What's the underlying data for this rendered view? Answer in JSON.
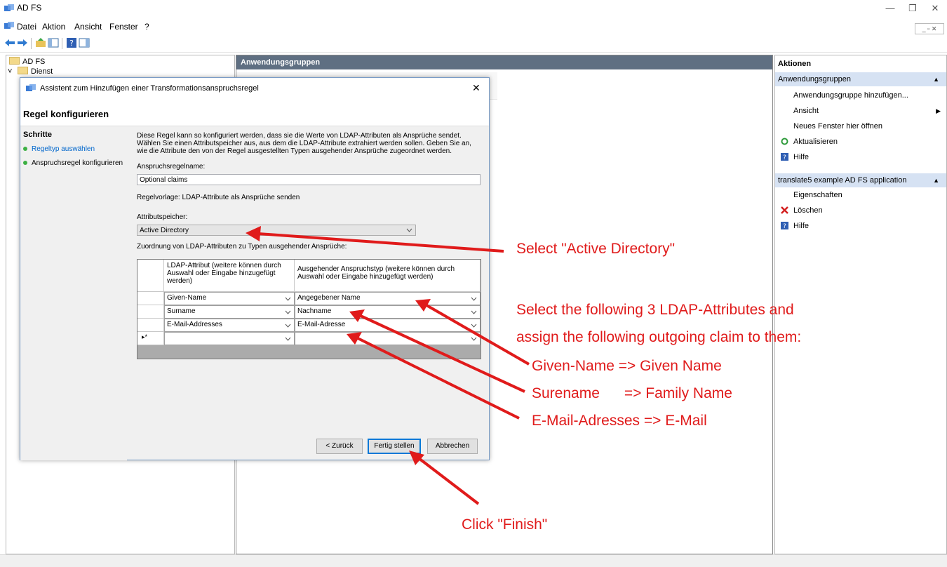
{
  "window": {
    "title": "AD FS",
    "minimize": "—",
    "restore": "❐",
    "close": "✕"
  },
  "menu": [
    "Datei",
    "Aktion",
    "Ansicht",
    "Fenster",
    "?"
  ],
  "mdi_buttons": "_ ▫ ✕",
  "tree": {
    "root": "AD FS",
    "child": "Dienst",
    "expander": "˅"
  },
  "center": {
    "header": "Anwendungsgruppen"
  },
  "actions": {
    "header": "Aktionen",
    "section1": "Anwendungsgruppen",
    "items1": [
      "Anwendungsgruppe hinzufügen...",
      "Ansicht",
      "Neues Fenster hier öffnen",
      "Aktualisieren",
      "Hilfe"
    ],
    "section2": "translate5 example AD FS application",
    "items2": [
      "Eigenschaften",
      "Löschen",
      "Hilfe"
    ],
    "collapse_glyph": "▲",
    "submenu_glyph": "▶"
  },
  "dialog": {
    "title": "Assistent zum Hinzufügen einer Transformationsanspruchsregel",
    "close": "✕",
    "heading": "Regel konfigurieren",
    "steps_title": "Schritte",
    "steps": [
      "Regeltyp auswählen",
      "Anspruchsregel konfigurieren"
    ],
    "description": "Diese Regel kann so konfiguriert werden, dass sie die Werte von LDAP-Attributen als Ansprüche sendet. Wählen Sie einen Attributspeicher aus, aus dem die LDAP-Attribute extrahiert werden sollen. Geben Sie an, wie die Attribute den von der Regel ausgestellten Typen ausgehender Ansprüche zugeordnet werden.",
    "rule_name_label": "Anspruchsregelname:",
    "rule_name_value": "Optional claims",
    "template_text": "Regelvorlage: LDAP-Attribute als Ansprüche senden",
    "store_label": "Attributspeicher:",
    "store_value": "Active Directory",
    "mapping_label": "Zuordnung von LDAP-Attributen zu Typen ausgehender Ansprüche:",
    "grid": {
      "col1": "LDAP-Attribut (weitere können durch Auswahl oder Eingabe hinzugefügt werden)",
      "col2": "Ausgehender Anspruchstyp (weitere können durch Auswahl oder Eingabe hinzugefügt werden)",
      "rows": [
        {
          "ldap": "Given-Name",
          "claim": "Angegebener Name"
        },
        {
          "ldap": "Surname",
          "claim": "Nachname"
        },
        {
          "ldap": "E-Mail-Addresses",
          "claim": "E-Mail-Adresse"
        }
      ],
      "new_row_marker": "▸*"
    },
    "buttons": {
      "back": "< Zurück",
      "finish": "Fertig stellen",
      "cancel": "Abbrechen"
    }
  },
  "annotations": {
    "select_ad": "Select \"Active Directory\"",
    "line1": "Select the following 3 LDAP-Attributes and",
    "line2": "assign the following outgoing claim to them:",
    "map1": "Given-Name  => Given Name",
    "map2": "Surename      => Family Name",
    "map3": "E-Mail-Adresses => E-Mail",
    "finish": "Click \"Finish\"",
    "color": "#e01b1b"
  },
  "colors": {
    "center_header": "#5f6f82",
    "action_section": "#d6e2f3",
    "step_link": "#0066cc",
    "step_dot": "#3cb043"
  }
}
